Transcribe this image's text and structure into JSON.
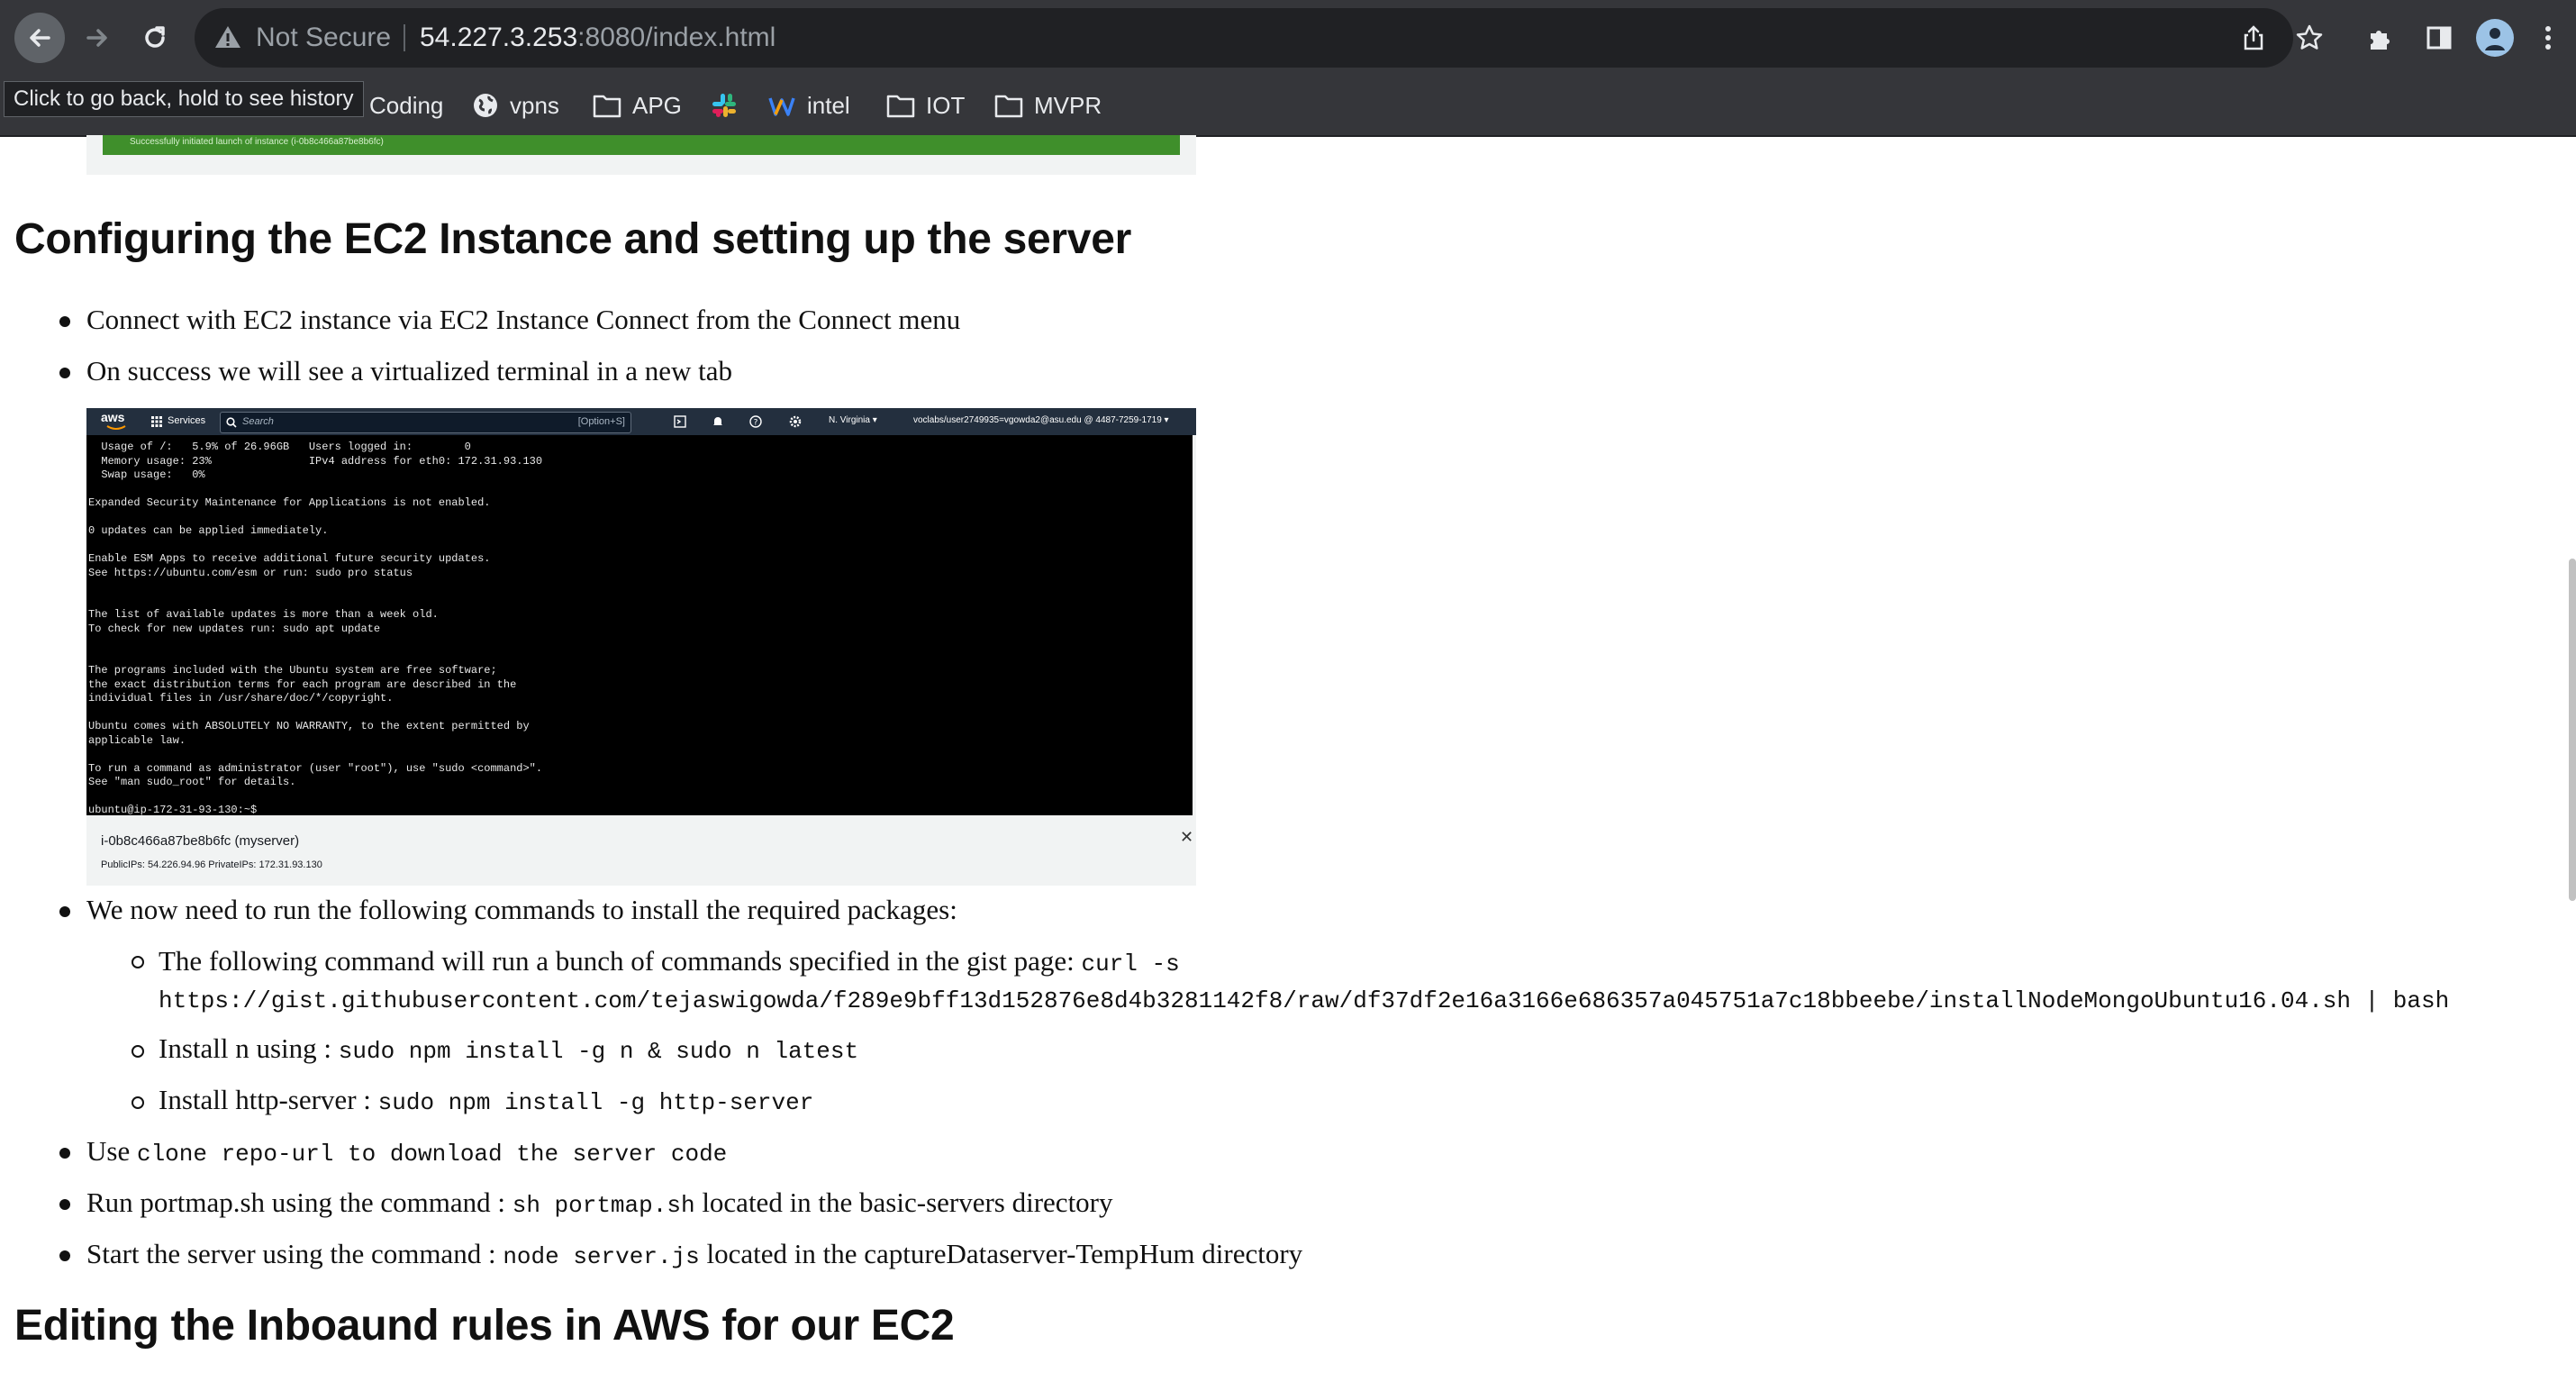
{
  "browser": {
    "security_label": "Not Secure",
    "url_host": "54.227.3.253",
    "url_rest": ":8080/index.html",
    "tooltip": "Click to go back, hold to see history",
    "bookmarks": [
      {
        "label": "Coding",
        "icon": "none"
      },
      {
        "label": "vpns",
        "icon": "globe-icon"
      },
      {
        "label": "APG",
        "icon": "folder-icon"
      },
      {
        "label": "",
        "icon": "slack-icon"
      },
      {
        "label": "intel",
        "icon": "w-logo-icon"
      },
      {
        "label": "IOT",
        "icon": "folder-icon"
      },
      {
        "label": "MVPR",
        "icon": "folder-icon"
      }
    ]
  },
  "banner": {
    "text": "Successfully initiated launch of instance (i-0b8c466a87be8b6fc)"
  },
  "section1": {
    "heading": "Configuring the EC2 Instance and setting up the server",
    "items": [
      "Connect with EC2 instance via EC2 Instance Connect from the Connect menu",
      "On success we will see a virtualized terminal in a new tab"
    ],
    "screenshot": {
      "aws_logo": "aws",
      "services": "Services",
      "search_placeholder": "Search",
      "search_shortcut": "[Option+S]",
      "region": "N. Virginia ▾",
      "account": "voclabs/user2749935=vgowda2@asu.edu @ 4487-7259-1719 ▾",
      "terminal_text": "  Usage of /:   5.9% of 26.96GB   Users logged in:        0\n  Memory usage: 23%               IPv4 address for eth0: 172.31.93.130\n  Swap usage:   0%\n\nExpanded Security Maintenance for Applications is not enabled.\n\n0 updates can be applied immediately.\n\nEnable ESM Apps to receive additional future security updates.\nSee https://ubuntu.com/esm or run: sudo pro status\n\n\nThe list of available updates is more than a week old.\nTo check for new updates run: sudo apt update\n\n\nThe programs included with the Ubuntu system are free software;\nthe exact distribution terms for each program are described in the\nindividual files in /usr/share/doc/*/copyright.\n\nUbuntu comes with ABSOLUTELY NO WARRANTY, to the extent permitted by\napplicable law.\n\nTo run a command as administrator (user \"root\"), use \"sudo <command>\".\nSee \"man sudo_root\" for details.\n\nubuntu@ip-172-31-93-130:~$",
      "instance": "i-0b8c466a87be8b6fc (myserver)",
      "ips": "PublicIPs: 54.226.94.96    PrivateIPs: 172.31.93.130",
      "close": "✕"
    },
    "packages_intro": "We now need to run the following commands to install the required packages:",
    "sub_items": [
      {
        "text": "The following command will run a bunch of commands specified in the gist page: ",
        "code": "curl -s",
        "code2": "https://gist.githubusercontent.com/tejaswigowda/f289e9bff13d152876e8d4b3281142f8/raw/df37df2e16a3166e686357a045751a7c18bbeebe/installNodeMongoUbuntu16.04.sh | bash"
      },
      {
        "text": "Install n using : ",
        "code": "sudo npm install -g n & sudo n latest"
      },
      {
        "text": "Install http-server : ",
        "code": "sudo npm install -g http-server"
      }
    ],
    "use_item": {
      "text": "Use ",
      "code": "clone repo-url to download the server code"
    },
    "run_item": {
      "text": "Run portmap.sh using the command : ",
      "code": "sh portmap.sh",
      "after": " located in the basic-servers directory"
    },
    "start_item": {
      "text": "Start the server using the command : ",
      "code": "node server.js",
      "after": " located in the captureDataserver-TempHum directory"
    }
  },
  "section2": {
    "heading": "Editing the Inboaund rules in AWS for our EC2"
  }
}
